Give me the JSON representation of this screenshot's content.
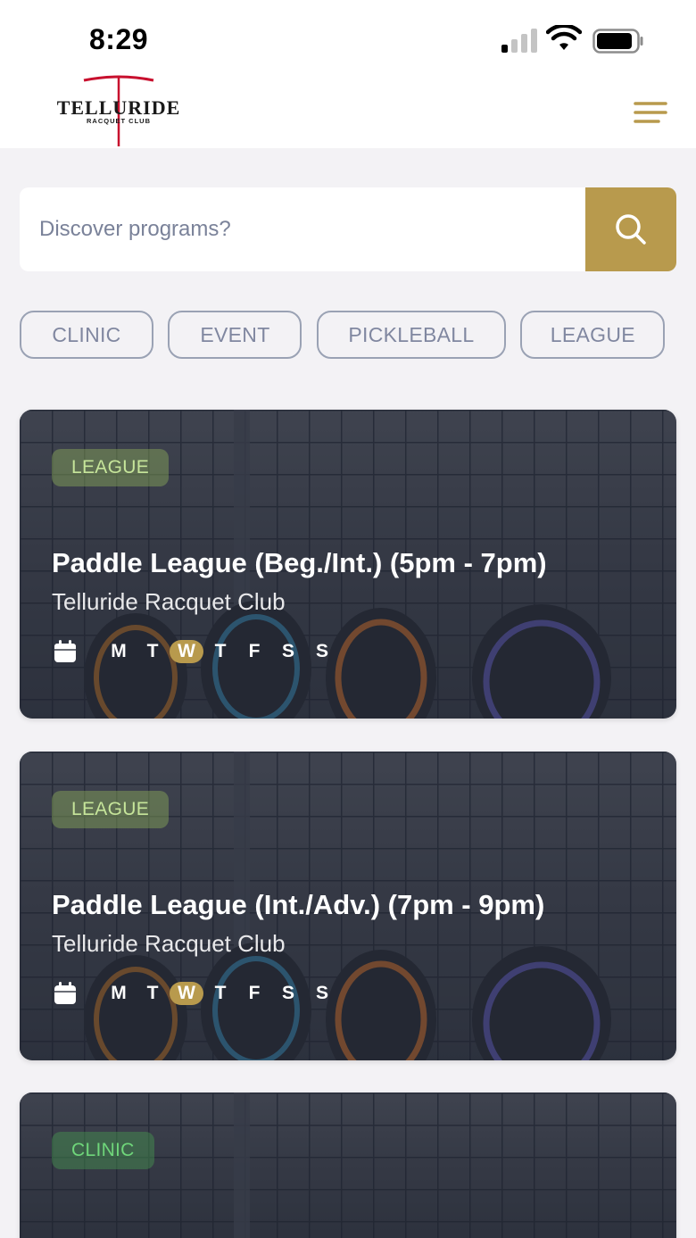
{
  "status_bar": {
    "time": "8:29"
  },
  "header": {
    "logo_text": "TELLURIDE",
    "logo_subtext": "RACQUET CLUB"
  },
  "search": {
    "placeholder": "Discover programs?"
  },
  "chips": [
    "CLINIC",
    "EVENT",
    "PICKLEBALL",
    "LEAGUE"
  ],
  "cards": [
    {
      "badge": "LEAGUE",
      "title": "Paddle League (Beg./Int.) (5pm - 7pm)",
      "subtitle": "Telluride Racquet Club",
      "days": [
        "M",
        "T",
        "W",
        "T",
        "F",
        "S",
        "S"
      ],
      "active_day": "W"
    },
    {
      "badge": "LEAGUE",
      "title": "Paddle League (Int./Adv.) (7pm - 9pm)",
      "subtitle": "Telluride Racquet Club",
      "days": [
        "M",
        "T",
        "W",
        "T",
        "F",
        "S",
        "S"
      ],
      "active_day": "W"
    },
    {
      "badge": "CLINIC"
    }
  ],
  "colors": {
    "accent": "#b89a4d",
    "logo_red": "#c8102e",
    "page_bg": "#f3f2f5",
    "chip_border": "#9aa2b4"
  },
  "icons": {
    "menu": "hamburger-icon",
    "search": "search-icon",
    "calendar": "calendar-icon"
  }
}
